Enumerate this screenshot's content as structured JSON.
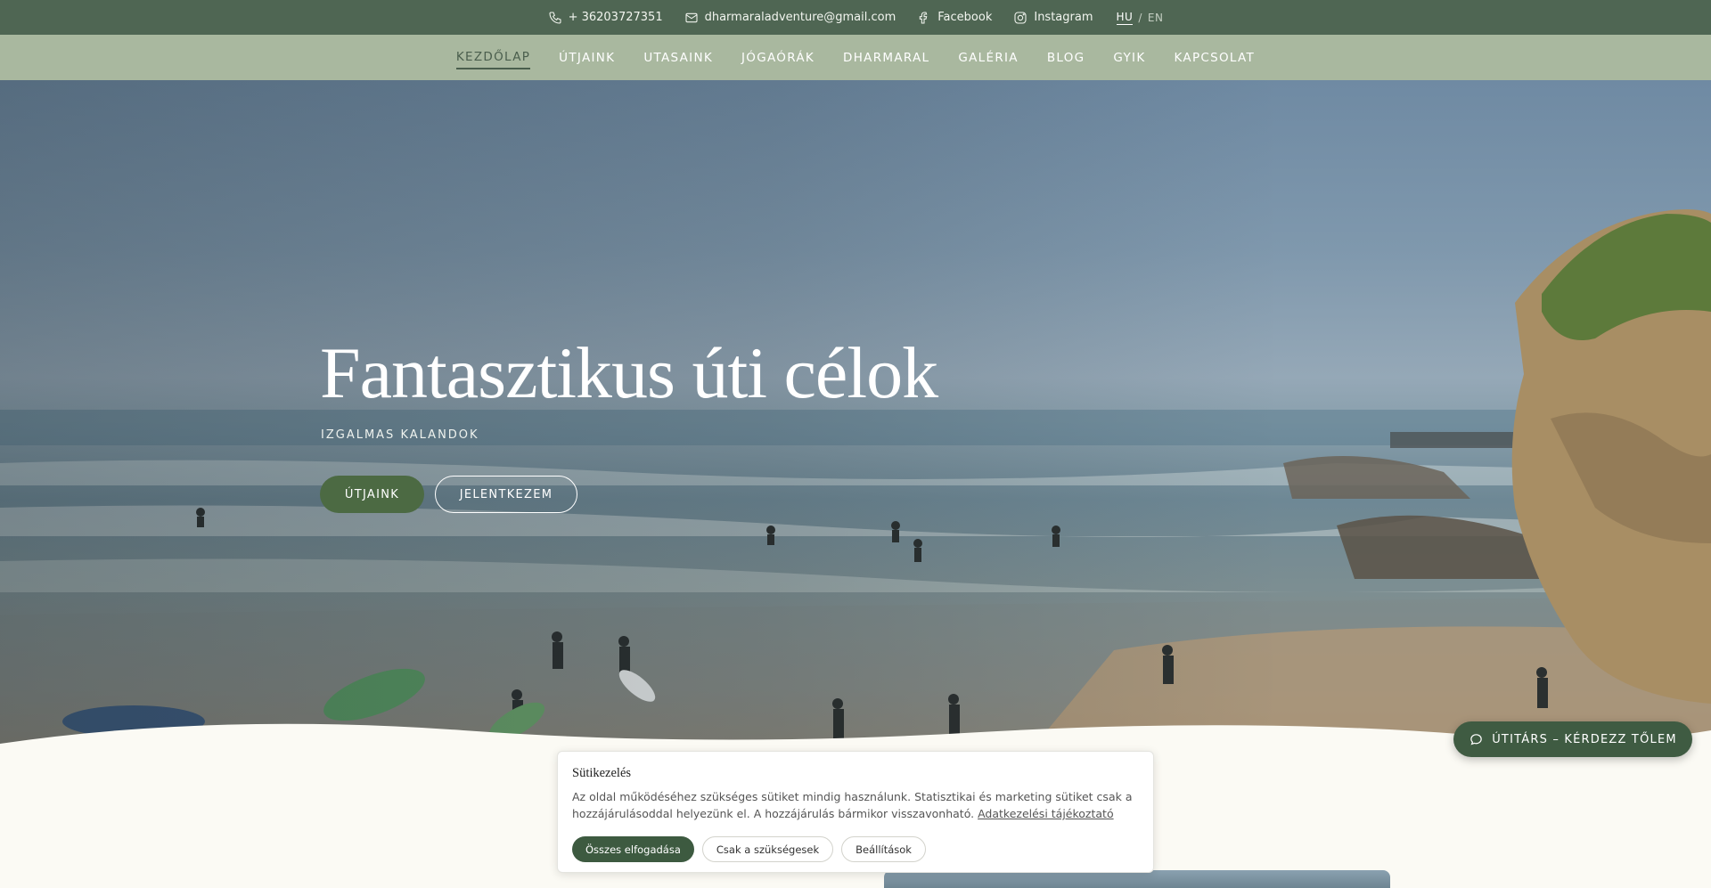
{
  "topbar": {
    "phone": "+ 36203727351",
    "email": "dharmaraladventure@gmail.com",
    "facebook": "Facebook",
    "instagram": "Instagram",
    "lang_active": "HU",
    "lang_sep": "/",
    "lang_other": "EN"
  },
  "nav": {
    "items": [
      {
        "label": "KEZDŐLAP",
        "active": true
      },
      {
        "label": "ÚTJAINK"
      },
      {
        "label": "UTASAINK"
      },
      {
        "label": "JÓGAÓRÁK"
      },
      {
        "label": "DHARMARAL"
      },
      {
        "label": "GALÉRIA"
      },
      {
        "label": "BLOG"
      },
      {
        "label": "GYIK"
      },
      {
        "label": "KAPCSOLAT"
      }
    ]
  },
  "hero": {
    "title": "Fantasztikus úti célok",
    "subtitle": "IZGALMAS KALANDOK",
    "primary_button": "ÚTJAINK",
    "secondary_button": "JELENTKEZEM"
  },
  "chat": {
    "label": "ÚTITÁRS – KÉRDEZZ TŐLEM"
  },
  "cookie": {
    "title": "Sütikezelés",
    "text": "Az oldal működéséhez szükséges sütiket mindig használunk. Statisztikai és marketing sütiket csak a hozzájárulásoddal helyezünk el. A hozzájárulás bármikor visszavonható.",
    "link": "Adatkezelési tájékoztató",
    "accept_all": "Összes elfogadása",
    "only_necessary": "Csak a szükségesek",
    "settings": "Beállítások"
  },
  "colors": {
    "topbar": "#4f6653",
    "nav": "#a9b89f",
    "accent": "#4c6a43",
    "chat": "#3f5b42",
    "page_bg": "#fbfaf4"
  }
}
